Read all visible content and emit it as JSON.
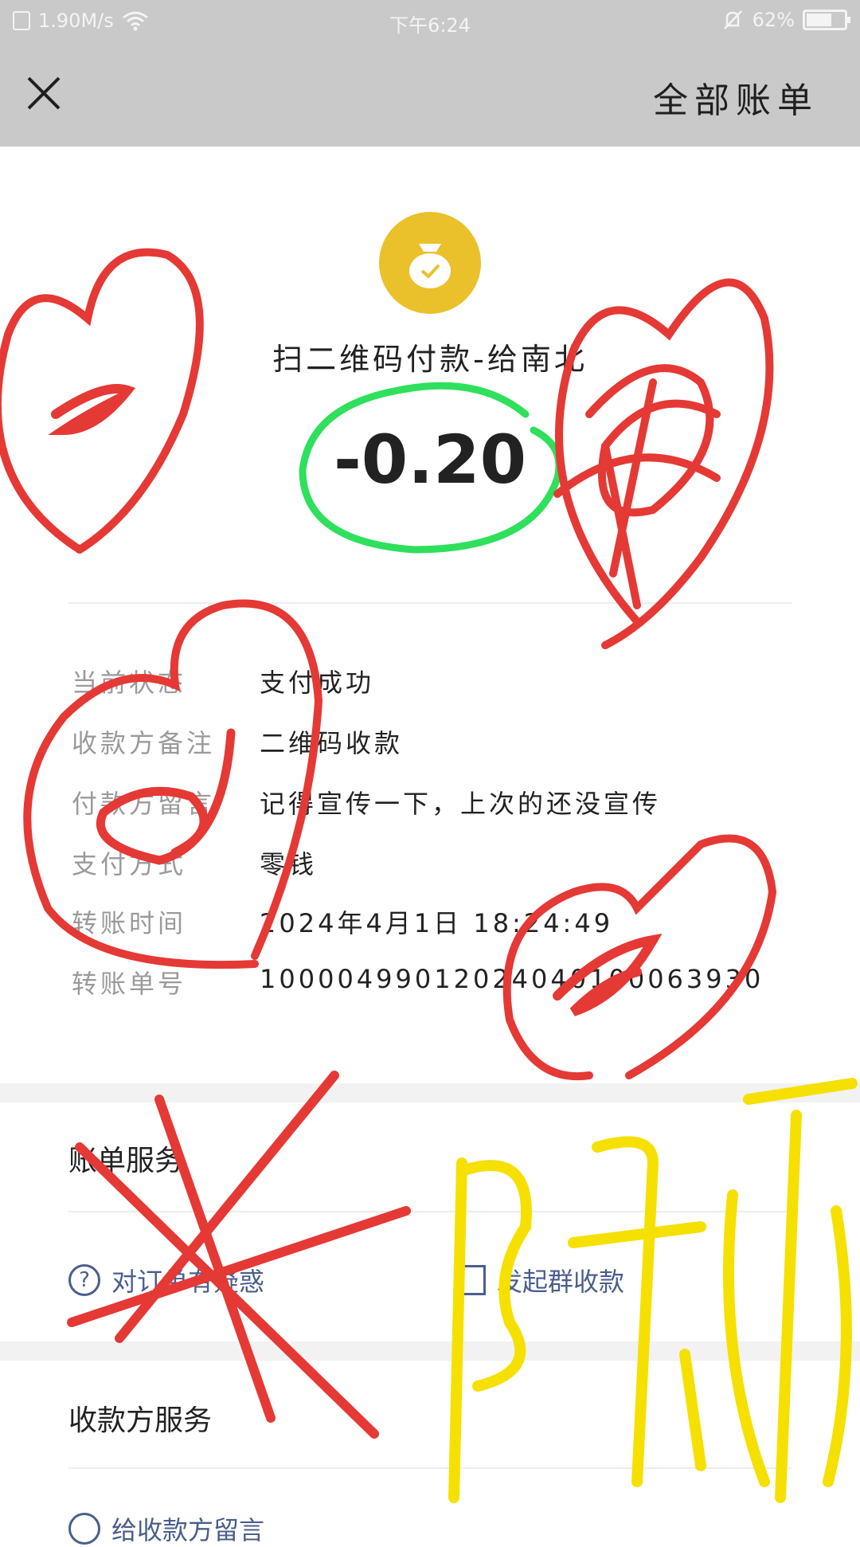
{
  "status_bar": {
    "speed": "1.90M/s",
    "time": "下午6:24",
    "battery": "62%",
    "icons": [
      "sim-icon",
      "wifi-icon",
      "mute-bell-icon",
      "battery-icon"
    ]
  },
  "header": {
    "close_icon": "close-icon",
    "all_bills": "全部账单"
  },
  "payment": {
    "icon": "money-bag-icon",
    "title": "扫二维码付款-给南北",
    "amount": "-0.20"
  },
  "details": [
    {
      "label": "当前状态",
      "value": "支付成功"
    },
    {
      "label": "收款方备注",
      "value": "二维码收款"
    },
    {
      "label": "付款方留言",
      "value": "记得宣传一下，上次的还没宣传"
    },
    {
      "label": "支付方式",
      "value": "零钱"
    },
    {
      "label": "转账时间",
      "value": "2024年4月1日 18:24:49"
    },
    {
      "label": "转账单号",
      "value": "10000499012024040100063930"
    }
  ],
  "bill_service": {
    "title": "账单服务",
    "links": [
      {
        "icon": "question-icon",
        "label": "对订单有疑惑"
      },
      {
        "icon": "document-icon",
        "label": "发起群收款"
      }
    ]
  },
  "payee_service": {
    "title": "收款方服务",
    "next_item": "给收款方留言"
  },
  "colors": {
    "header_bg": "#c9c9c9",
    "icon_yellow": "#eac02b",
    "link_blue": "#4a5e8e",
    "scribble_red": "#e53935",
    "scribble_green": "#2ee05c",
    "scribble_yellow": "#f5e000"
  }
}
